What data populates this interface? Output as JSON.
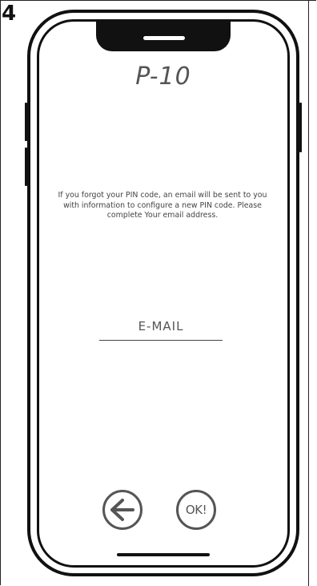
{
  "step": {
    "number": "4"
  },
  "screen": {
    "title": "P-10",
    "info_text": "If you forgot your PIN code, an email will be sent to you with information to configure a new PIN code. Please complete Your email address.",
    "email": {
      "placeholder": "E-MAIL",
      "value": ""
    },
    "back_button": {
      "icon": "arrow-left-icon"
    },
    "ok_button": {
      "label": "OK!"
    }
  },
  "colors": {
    "frame": "#111111",
    "text": "#555555",
    "background": "#ffffff"
  }
}
